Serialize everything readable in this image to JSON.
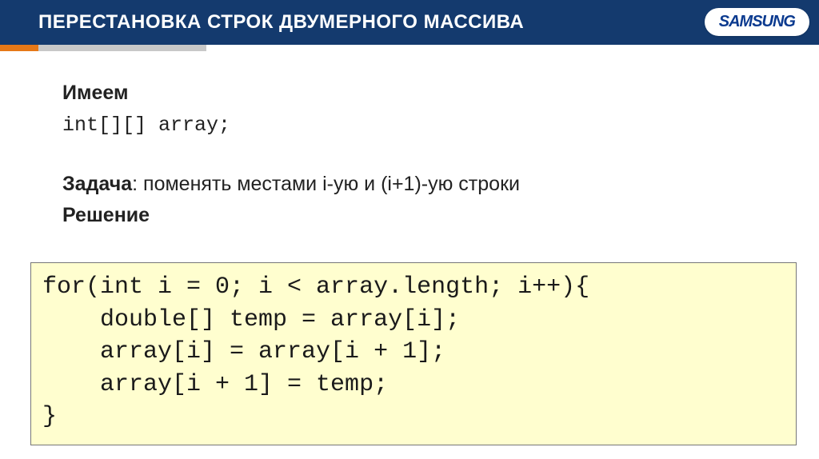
{
  "header": {
    "title": "ПЕРЕСТАНОВКА СТРОК ДВУМЕРНОГО МАССИВА",
    "brand": "SAMSUNG"
  },
  "content": {
    "have_label": "Имеем",
    "declaration": "int[][] array;",
    "task_label": "Задача",
    "task_text": ": поменять местами i-ую и (i+1)-ую строки",
    "solution_label": "Решение"
  },
  "code": {
    "line1": "for(int i = 0; i < array.length; i++){",
    "line2": "    double[] temp = array[i];",
    "line3": "    array[i] = array[i + 1];",
    "line4": "    array[i + 1] = temp;",
    "line5": "}"
  }
}
